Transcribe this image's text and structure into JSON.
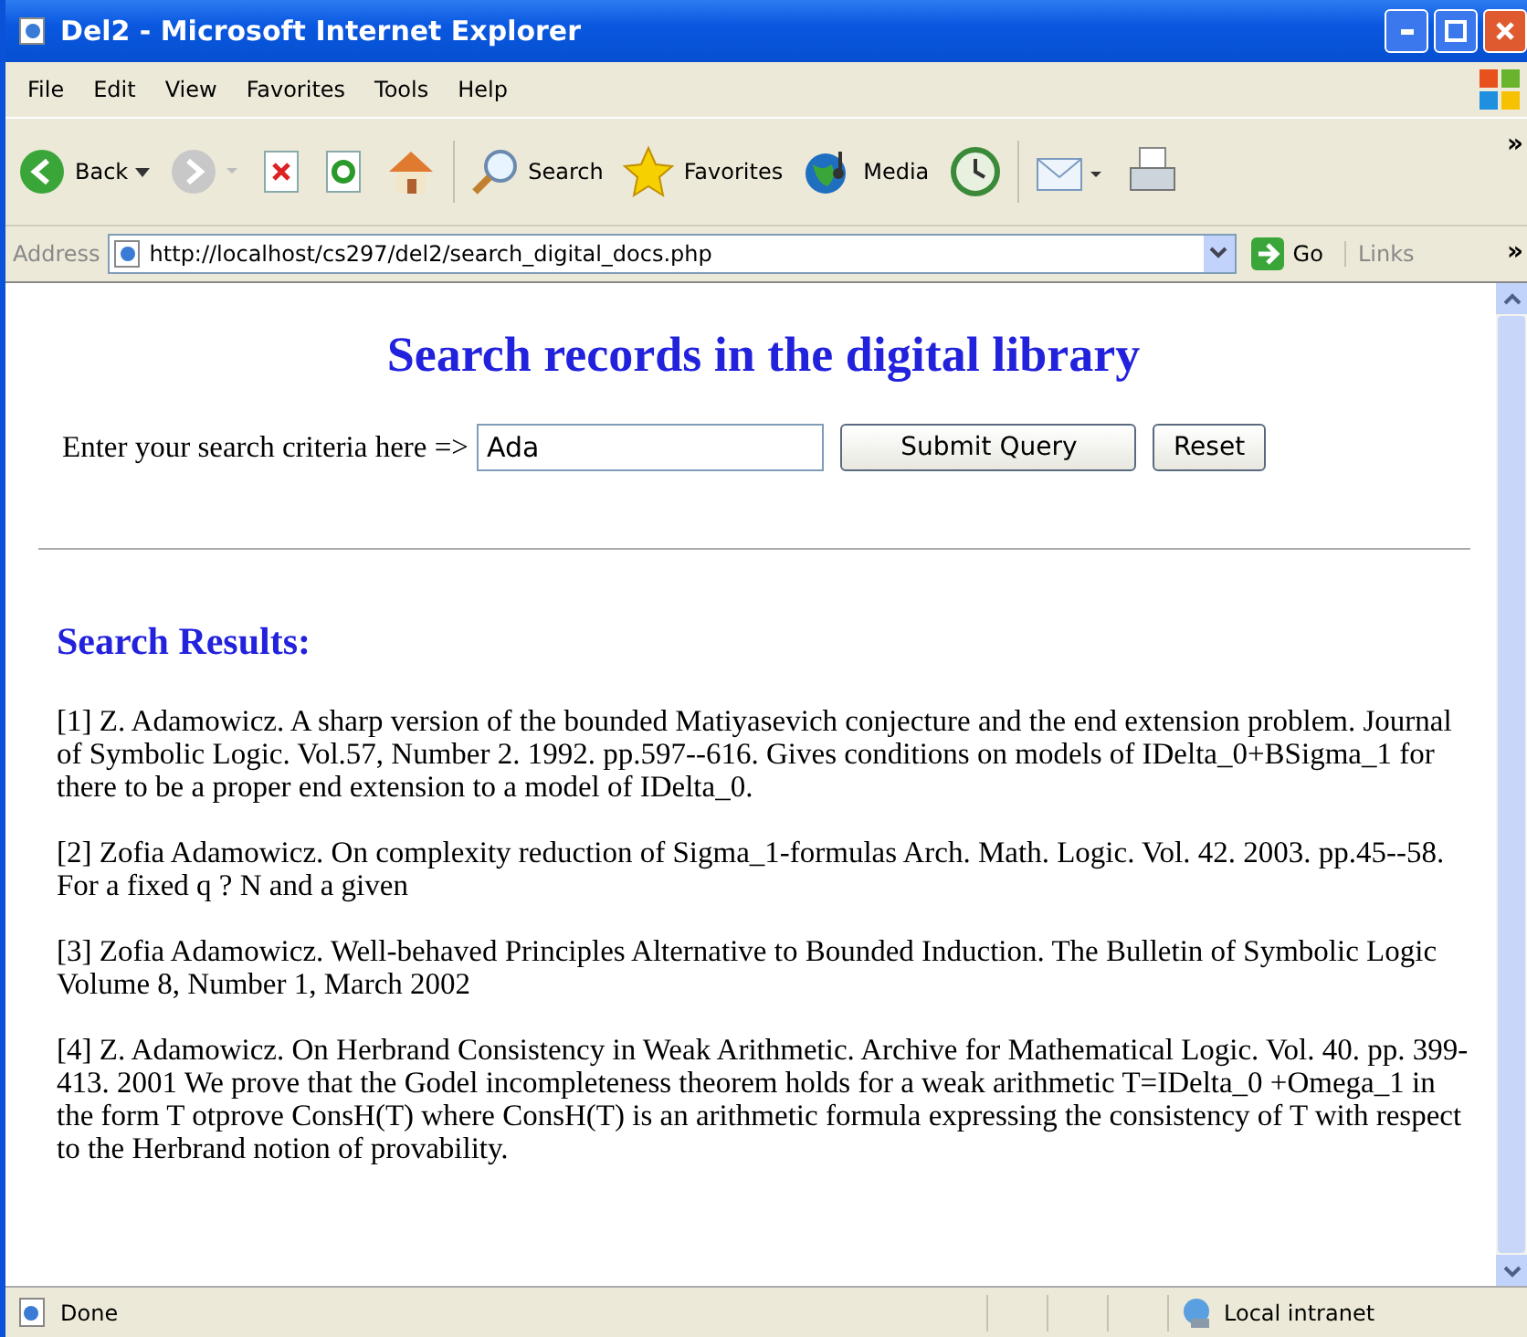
{
  "window": {
    "title": "Del2 - Microsoft Internet Explorer"
  },
  "menu": [
    "File",
    "Edit",
    "View",
    "Favorites",
    "Tools",
    "Help"
  ],
  "toolbar": [
    {
      "kind": "back",
      "label": "Back"
    },
    {
      "kind": "forward"
    },
    {
      "kind": "stop"
    },
    {
      "kind": "refresh"
    },
    {
      "kind": "home"
    },
    {
      "kind": "search",
      "label": "Search"
    },
    {
      "kind": "favorites",
      "label": "Favorites"
    },
    {
      "kind": "media",
      "label": "Media"
    },
    {
      "kind": "history"
    },
    {
      "kind": "mail"
    },
    {
      "kind": "print"
    }
  ],
  "toolbar_overflow": "»",
  "address_bar": {
    "label": "Address",
    "url": "http://localhost/cs297/del2/search_digital_docs.php",
    "go": "Go",
    "links": "Links",
    "links_overflow": "»"
  },
  "page": {
    "heading": "Search records in the digital library",
    "search_label": "Enter your search criteria here =>",
    "search_value": "Ada",
    "submit": "Submit Query",
    "reset": "Reset",
    "results_heading": "Search Results:",
    "results": [
      "[1] Z. Adamowicz. A sharp version of the bounded Matiyasevich conjecture and the end extension problem. Journal of Symbolic Logic. Vol.57, Number 2. 1992. pp.597--616. Gives conditions on models of IDelta_0+BSigma_1 for there to be a proper end extension to a model of IDelta_0.",
      "[2] Zofia Adamowicz. On complexity reduction of Sigma_1-formulas Arch. Math. Logic. Vol. 42. 2003. pp.45--58. For a fixed q ? N and a given",
      "[3] Zofia Adamowicz. Well-behaved Principles Alternative to Bounded Induction. The Bulletin of Symbolic Logic Volume 8, Number 1, March 2002",
      "[4] Z. Adamowicz. On Herbrand Consistency in Weak Arithmetic. Archive for Mathematical Logic. Vol. 40. pp. 399-413. 2001 We prove that the Godel incompleteness theorem holds for a weak arithmetic T=IDelta_0 +Omega_1 in the form T otprove ConsH(T) where ConsH(T) is an arithmetic formula expressing the consistency of T with respect to the Herbrand notion of provability."
    ]
  },
  "status_bar": {
    "text": "Done",
    "zone": "Local intranet"
  }
}
